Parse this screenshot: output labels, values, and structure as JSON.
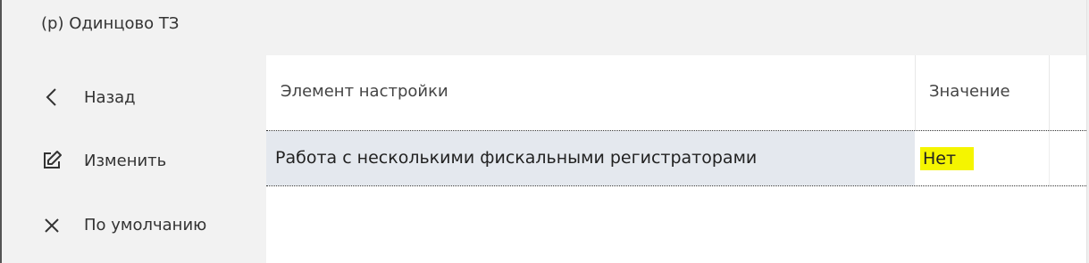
{
  "window": {
    "title": "(р) Одинцово ТЗ"
  },
  "sidebar": {
    "items": [
      {
        "label": "Назад",
        "icon": "chevron-left-icon"
      },
      {
        "label": "Изменить",
        "icon": "edit-icon"
      },
      {
        "label": "По умолчанию",
        "icon": "close-icon"
      }
    ]
  },
  "table": {
    "columns": [
      "Элемент настройки",
      "Значение"
    ],
    "rows": [
      {
        "name": "Работа с несколькими фискальными регистраторами",
        "value": "Нет"
      }
    ]
  },
  "colors": {
    "panel_bg": "#f2f2f2",
    "selected_row": "#e4e8ee",
    "value_highlight": "#f5f500"
  }
}
